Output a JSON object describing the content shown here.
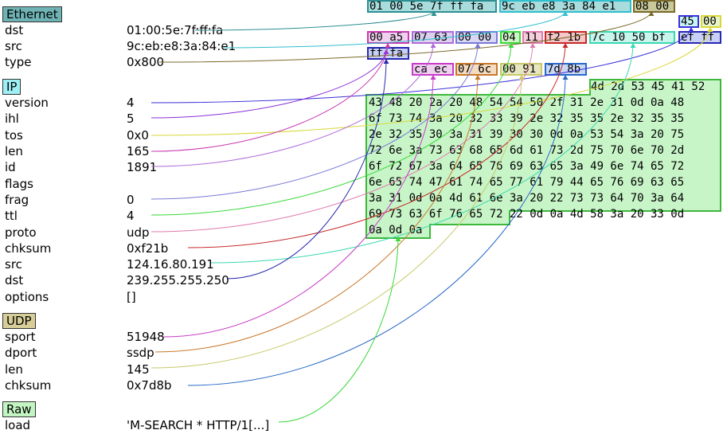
{
  "colors": {
    "ethernet": "#6fb3b5",
    "ip": "#9ff0f5",
    "udp": "#d6cd98",
    "raw": "#c3f5c3",
    "payload_fill": "#c8f5c8",
    "payload_border": "#3db83d"
  },
  "layers": [
    {
      "name": "Ethernet",
      "color": "#6fb3b5",
      "fields": [
        {
          "name": "dst",
          "value": "01:00:5e:7f:ff:fa",
          "hex": "01 00 5e 7f ff fa",
          "edge": "#2d8f92",
          "fill": "#a9dcdc"
        },
        {
          "name": "src",
          "value": "9c:eb:e8:3a:84:e1",
          "hex": "9c eb e8 3a 84 e1",
          "edge": "#2fbfcf",
          "fill": "#a9dcdc"
        },
        {
          "name": "type",
          "value": "0x800",
          "hex": "08 00",
          "edge": "#7a6a2a",
          "fill": "#c8c89a"
        }
      ]
    },
    {
      "name": "IP",
      "color": "#9ff0f5",
      "fields": [
        {
          "name": "version",
          "value": "4",
          "hex": "45",
          "edge": "#3a2fd8",
          "fill": "#c8f5f5"
        },
        {
          "name": "ihl",
          "value": "5",
          "hex": "",
          "edge": "#8a2fd8",
          "fill": ""
        },
        {
          "name": "tos",
          "value": "0x0",
          "hex": "00",
          "edge": "#d8d83a",
          "fill": "#e6f5c8"
        },
        {
          "name": "len",
          "value": "165",
          "hex": "00 a5",
          "edge": "#c83ab0",
          "fill": "#f0d0ef"
        },
        {
          "name": "id",
          "value": "1891",
          "hex": "07 63",
          "edge": "#b06bd8",
          "fill": "#dcd0f0"
        },
        {
          "name": "flags",
          "value": "",
          "hex": "00 00",
          "edge": "#7a7ad8",
          "fill": "#d8d8f5"
        },
        {
          "name": "frag",
          "value": "0",
          "hex": "",
          "edge": "#7a7ad8",
          "fill": ""
        },
        {
          "name": "ttl",
          "value": "4",
          "hex": "04",
          "edge": "#3ad83a",
          "fill": "#d0f5c8"
        },
        {
          "name": "proto",
          "value": "udp",
          "hex": "11",
          "edge": "#e07ab0",
          "fill": "#f5d0dc"
        },
        {
          "name": "chksum",
          "value": "0xf21b",
          "hex": "f2 1b",
          "edge": "#c82828",
          "fill": "#f5c8c8"
        },
        {
          "name": "src",
          "value": "124.16.80.191",
          "hex": "7c 10 50 bf",
          "edge": "#3ad8b0",
          "fill": "#c8f5ec"
        },
        {
          "name": "dst",
          "value": "239.255.255.250",
          "hex": "ef ff ff fa",
          "edge": "#2828b0",
          "fill": "#c8d0f5"
        },
        {
          "name": "options",
          "value": "[]",
          "hex": "",
          "edge": "",
          "fill": ""
        }
      ]
    },
    {
      "name": "UDP",
      "color": "#d6cd98",
      "fields": [
        {
          "name": "sport",
          "value": "51948",
          "hex": "ca ec",
          "edge": "#c83ac8",
          "fill": "#f0d0ef"
        },
        {
          "name": "dport",
          "value": "ssdp",
          "hex": "07 6c",
          "edge": "#c8782a",
          "fill": "#f5dcc0"
        },
        {
          "name": "len",
          "value": "145",
          "hex": "00 91",
          "edge": "#c8c86a",
          "fill": "#e6e6c0"
        },
        {
          "name": "chksum",
          "value": "0x7d8b",
          "hex": "7d 8b",
          "edge": "#2a6ac8",
          "fill": "#c8d8f5"
        }
      ]
    },
    {
      "name": "Raw",
      "color": "#c3f5c3",
      "fields": [
        {
          "name": "load",
          "value": "'M-SEARCH * HTTP/1[...]",
          "hex": "",
          "edge": "#3ad83a",
          "fill": ""
        }
      ]
    }
  ],
  "payload_lines": [
    "4d 2d 53 45 41 52",
    "43 48 20 2a 20 48 54 54 50 2f 31 2e 31 0d 0a 48",
    "6f 73 74 3a 20 32 33 39 2e 32 35 35 2e 32 35 35",
    "2e 32 35 30 3a 31 39 30 30 0d 0a 53 54 3a 20 75",
    "72 6e 3a 73 63 68 65 6d 61 73 2d 75 70 6e 70 2d",
    "6f 72 67 3a 64 65 76 69 63 65 3a 49 6e 74 65 72",
    "6e 65 74 47 61 74 65 77 61 79 44 65 76 69 63 65",
    "3a 31 0d 0a 4d 61 6e 3a 20 22 73 73 64 70 3a 64",
    "69 73 63 6f 76 65 72 22 0d 0a 4d 58 3a 20 33 0d",
    "0a 0d 0a"
  ]
}
